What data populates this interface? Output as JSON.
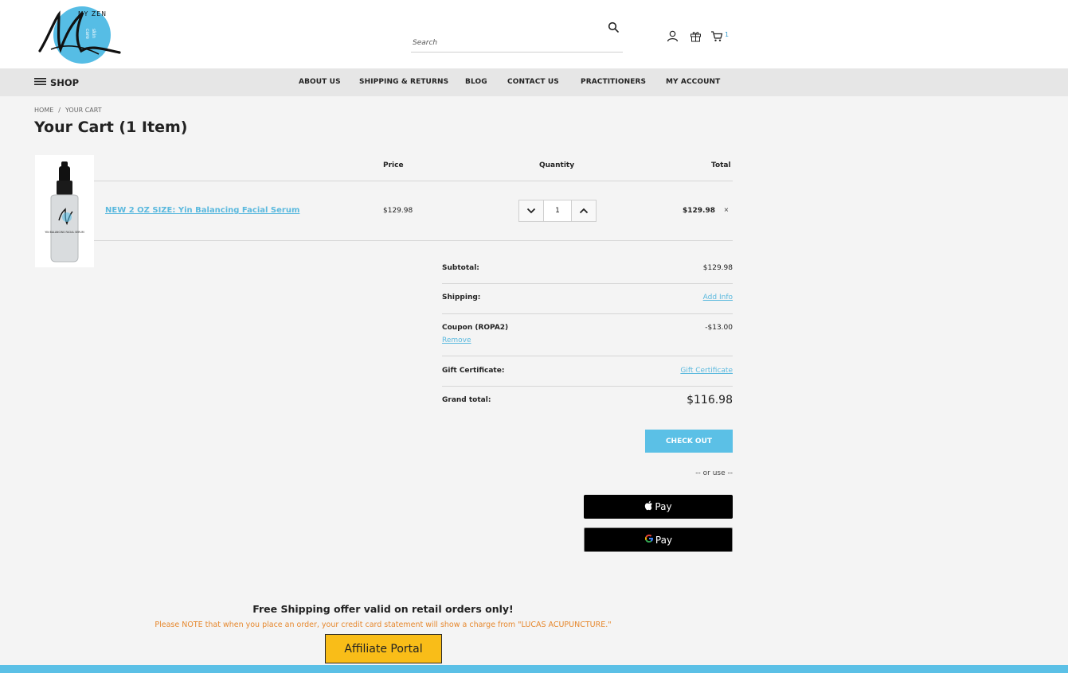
{
  "header": {
    "logo": {
      "line1": "MY ZEN",
      "line2": "skin",
      "line3": "care"
    },
    "search": {
      "placeholder": "Search",
      "value": ""
    },
    "cart_count": "1"
  },
  "nav": {
    "shop_label": "SHOP",
    "items": [
      "ABOUT US",
      "SHIPPING & RETURNS",
      "BLOG",
      "CONTACT US",
      "PRACTITIONERS",
      "MY ACCOUNT"
    ]
  },
  "breadcrumb": {
    "home": "HOME",
    "sep": "/",
    "current": "YOUR CART"
  },
  "page_title": "Your Cart (1 Item)",
  "cart": {
    "headers": {
      "price": "Price",
      "quantity": "Quantity",
      "total": "Total"
    },
    "item": {
      "name": "NEW 2 OZ SIZE: Yin Balancing Facial Serum",
      "bottle_label": "YIN BALANCING FACIAL SERUM",
      "price": "$129.98",
      "quantity": "1",
      "total": "$129.98",
      "remove": "×"
    }
  },
  "totals": {
    "subtotal_label": "Subtotal:",
    "subtotal_value": "$129.98",
    "shipping_label": "Shipping:",
    "shipping_link": "Add Info",
    "coupon_label": "Coupon (ROPA2)",
    "coupon_value": "-$13.00",
    "coupon_remove": "Remove",
    "gift_label": "Gift Certificate:",
    "gift_link": "Gift Certificate",
    "grand_label": "Grand total:",
    "grand_value": "$116.98"
  },
  "checkout": {
    "button": "CHECK OUT",
    "or_use": "-- or use --",
    "apple_pay": "Pay",
    "google_pay": "Pay"
  },
  "footer": {
    "free_shipping": "Free Shipping offer valid on retail orders only!",
    "note": "Please NOTE that when you place an order, your credit card statement will show a charge from \"LUCAS ACUPUNCTURE.\"",
    "affiliate": "Affiliate Portal"
  },
  "colors": {
    "accent": "#5bc0e6",
    "link": "#5bb9de",
    "note": "#e6882e",
    "affiliate_bg": "#f9bd18",
    "nav_bg": "#e6e6e6"
  }
}
